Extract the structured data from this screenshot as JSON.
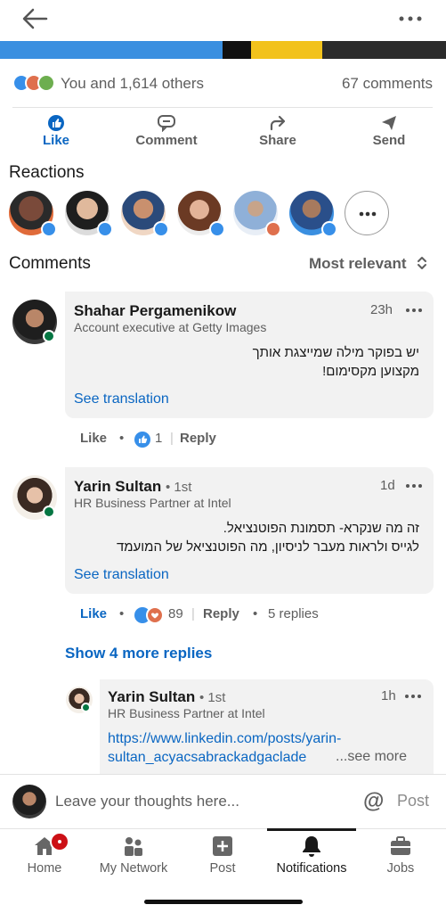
{
  "social": {
    "likes_text": "You and 1,614 others",
    "comments_count": "67 comments"
  },
  "actions": {
    "like": "Like",
    "comment": "Comment",
    "share": "Share",
    "send": "Send"
  },
  "reactions": {
    "title": "Reactions"
  },
  "comments_header": {
    "title": "Comments",
    "sort": "Most relevant"
  },
  "comments": [
    {
      "name": "Shahar Pergamenikow",
      "degree": "",
      "headline": "Account executive at Getty Images",
      "time": "23h",
      "text_line1": "יש בפוקר מילה שמייצגת אותך",
      "text_line2": "מקצוען מקסימום!",
      "translate": "See translation",
      "like_label": "Like",
      "reaction_count": "1",
      "reply_label": "Reply",
      "replies": ""
    },
    {
      "name": "Yarin Sultan",
      "degree": "• 1st",
      "headline": "HR Business Partner at Intel",
      "time": "1d",
      "text_line1": "זה מה שנקרא- תסמונת הפוטנציאל.",
      "text_line2": "לגייס ולראות מעבר לניסיון, מה הפוטנציאל של המועמד",
      "translate": "See translation",
      "like_label": "Like",
      "reaction_count": "89",
      "reply_label": "Reply",
      "replies": "5 replies"
    }
  ],
  "show_more": "Show 4 more replies",
  "reply": {
    "name": "Yarin Sultan",
    "degree": "• 1st",
    "headline": "HR Business Partner at Intel",
    "time": "1h",
    "link_line1": "https://www.linkedin.com/posts/yarin-",
    "link_line2": "sultan_acyacsabrackadgaclade",
    "see_more": "...see more"
  },
  "compose": {
    "placeholder": "Leave your thoughts here...",
    "at": "@",
    "post": "Post"
  },
  "nav": {
    "home": "Home",
    "network": "My Network",
    "post": "Post",
    "notifications": "Notifications",
    "jobs": "Jobs"
  },
  "colors": {
    "accent": "#0a66c2",
    "online": "#057642",
    "badge": "#cc1016"
  }
}
